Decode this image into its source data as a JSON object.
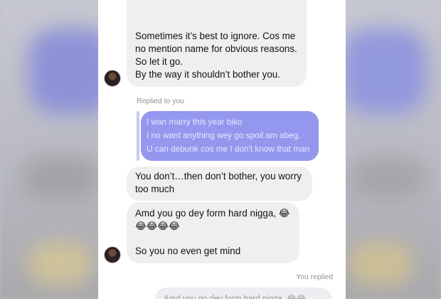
{
  "messages": {
    "first": {
      "lines": [
        "Sometimes it’s best to ignore. Cos me",
        "no mention name for obvious reasons.",
        "So let it go.",
        "By the way it shouldn’t bother you."
      ]
    },
    "reply_meta": "Replied to you",
    "quoted": {
      "lines": [
        "I wan marry this year biko",
        "I no want anything wey go spoil am abeg.",
        "U can debunk cos me I don't know that man"
      ]
    },
    "second": {
      "lines": [
        "You don’t…then don’t bother, you worry",
        "too much"
      ]
    },
    "third": {
      "line1": "Amd you go dey form hard nigga, 😂",
      "line2": "😂😂😂😂",
      "line3": "So you no even get mind"
    },
    "you_replied_meta": "You replied",
    "sent_preview": "Amd you go dey form hard nigga, 😂😂"
  }
}
